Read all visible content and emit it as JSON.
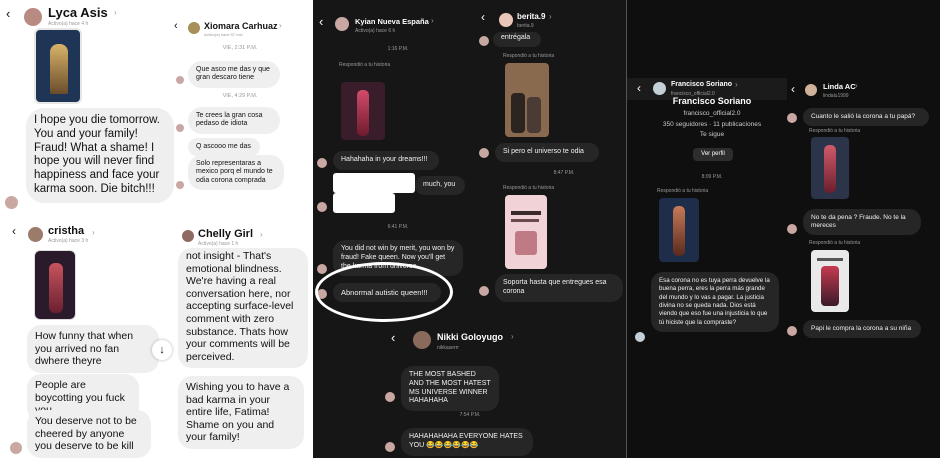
{
  "panel1": {
    "lyca": {
      "name": "Lyca Asis",
      "status": "Activo(a) hace 4 h",
      "message": "I hope you die tomorrow. You and your family! Fraud! What a shame! I hope you will never find happiness and face your karma soon. Die bitch!!!"
    },
    "xiomara": {
      "name": "Xiomara Carhuaz",
      "status": "Activo(a) hace 57 min",
      "time1": "VIE, 2:31 P.M.",
      "msg1": "Que asco me das y que gran descaro tiene",
      "time2": "VIE, 4:29 P.M.",
      "msg2": "Te crees la gran cosa pedaso de idiota",
      "msg3": "Q ascooo me das",
      "msg4": "Solo representaras a mexico porq el mundo te odia corona comprada"
    },
    "cristha": {
      "name": "cristha",
      "status": "Activo(a) hace 3 h",
      "msg1": "How funny that when you arrived no fan dwhere theyre",
      "msg2": "People are boycotting you fuck you",
      "msg3": "You deserve not to be cheered by anyone you deserve to be kill"
    },
    "chelly": {
      "name": "Chelly Girl",
      "status": "Activo(a) hace 1 h",
      "msg1": "not insight - That's emotional blindness. We're having a real conversation here, nor accepting surface-level comment with zero substance. Thats how your comments will be perceived.",
      "msg2": "Wishing you to have a bad karma in your entire life, Fatima! Shame on you and your family!"
    }
  },
  "panel2": {
    "kyian": {
      "name": "Kyian Nueva España",
      "status": "Activo(a) hace 6 h",
      "time1": "1:16 P.M.",
      "reply_label": "Respondió a tu historia",
      "msg1": "Hahahaha in your dreams!!!",
      "msg2": "much, you",
      "time2": "6:41 P.M.",
      "msg3": "You did not win by merit, you won by fraud! Fake queen. Now you'll get the karma from universe.",
      "msg4": "Abnormal autistic queen!!!"
    },
    "berita": {
      "name": "berita.9",
      "status": "berita.9",
      "msg0": "entrégala",
      "reply_label1": "Respondió a tu historia",
      "msg1": "Si pero el universo te odia",
      "time1": "8:47 P.M.",
      "reply_label2": "Respondió a tu historia",
      "msg2": "Soporta hasta que entregues esa corona"
    },
    "nikki": {
      "name": "Nikki Goloyugo",
      "handle": "nikkaserrr",
      "msg1": "THE MOST BASHED AND THE MOST HATEST MS UNIVERSE WINNER HAHAHAHA",
      "time1": "7:54 P.M.",
      "msg2": "HAHAHAHAHA EVERYONE HATES YOU 😂😂😂😂😂😂"
    }
  },
  "panel3": {
    "francisco": {
      "header_name": "Francisco Soriano",
      "header_handle": "francisco_official2.0",
      "profile_name": "Francisco Soriano",
      "profile_handle": "francisco_official2.0",
      "stats": "350 seguidores · 11 publicaciones",
      "follows": "Te sigue",
      "view_profile": "Ver perfil",
      "time1": "8:09 P.M.",
      "reply_label": "Respondió a tu historia",
      "msg1": "Esa corona no es tuya perra devuelve la buena perra, eres la perra más grande del mundo y lo vas a pagar. La justicia divina no se queda nada. Dios está viendo que eso fue una injusticia lo que tú hiciste que la compraste?"
    },
    "linda": {
      "name": "Linda AC",
      "handle": "lindalu1999",
      "msg1": "Cuanto le salió la corona a tu papá?",
      "reply_label1": "Respondió a tu historia",
      "msg2": "No te da pena ? Fraude. No te la mereces",
      "reply_label2": "Respondió a tu historia",
      "msg3": "Papi le compra la corona a su niña"
    }
  },
  "colors": {
    "light_bg": "#ffffff",
    "dark_bg": "#121212",
    "bubble_light": "#efefef",
    "bubble_dark": "#262626",
    "highlight_circle": "#ffffff"
  }
}
